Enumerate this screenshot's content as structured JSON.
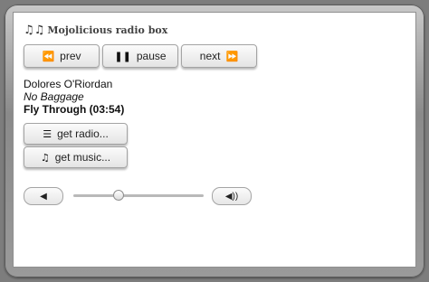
{
  "app": {
    "title": "Mojolicious radio box",
    "title_icon": "music-notes-icon"
  },
  "controls": {
    "prev": {
      "label": "prev",
      "icon": "rewind-icon"
    },
    "pause": {
      "label": "pause",
      "icon": "pause-icon"
    },
    "next": {
      "label": "next",
      "icon": "fast-forward-icon"
    }
  },
  "track": {
    "artist": "Dolores O'Riordan",
    "album": "No Baggage",
    "song": "Fly Through (03:54)"
  },
  "actions": {
    "get_radio": {
      "label": "get radio...",
      "icon": "list-icon"
    },
    "get_music": {
      "label": "get music...",
      "icon": "music-note-icon"
    }
  },
  "volume": {
    "level": 0.35,
    "down_icon": "volume-down-icon",
    "up_icon": "volume-up-icon"
  }
}
